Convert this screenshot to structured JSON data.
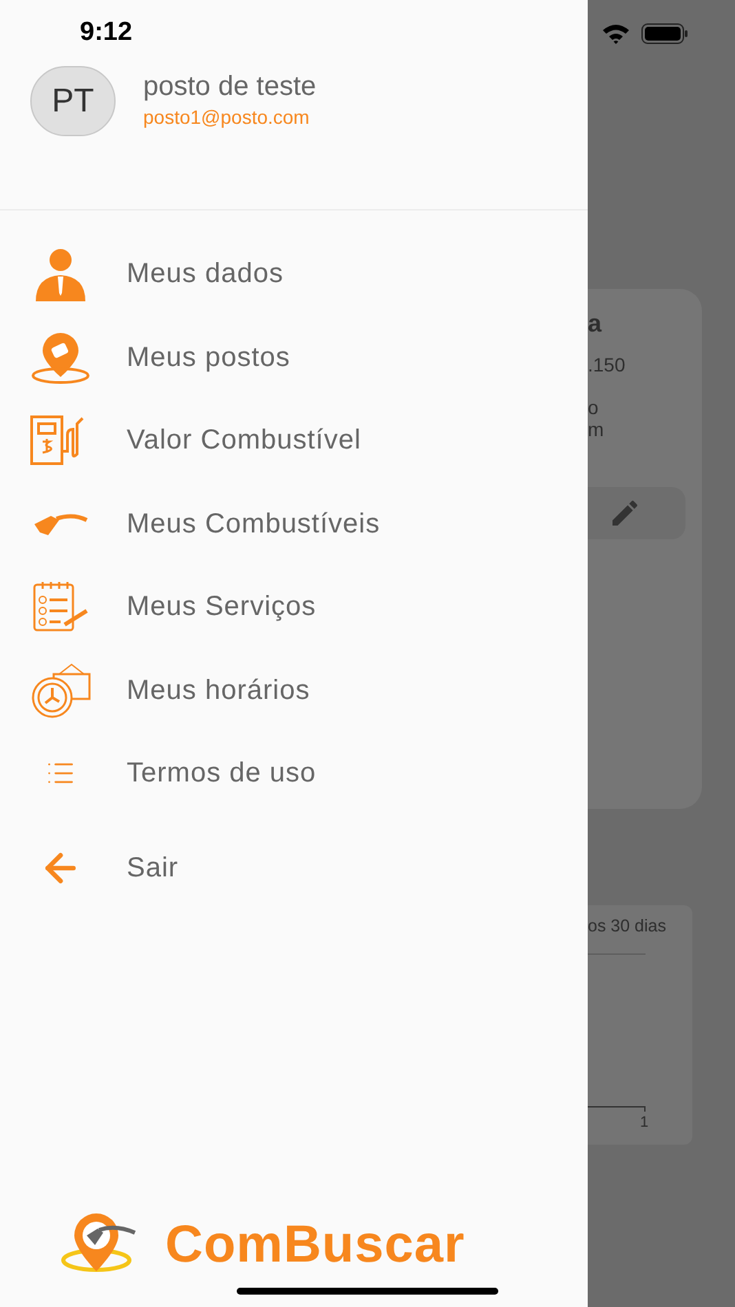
{
  "status_bar": {
    "time": "9:12"
  },
  "profile": {
    "initials": "PT",
    "name": "posto de teste",
    "email": "posto1@posto.com"
  },
  "menu": [
    {
      "kind": "person",
      "label": "Meus dados"
    },
    {
      "kind": "pin",
      "label": "Meus postos"
    },
    {
      "kind": "pump",
      "label": "Valor Combustível"
    },
    {
      "kind": "nozzle",
      "label": "Meus Combustíveis"
    },
    {
      "kind": "checklist",
      "label": "Meus Serviços"
    },
    {
      "kind": "clock",
      "label": "Meus horários"
    },
    {
      "kind": "list",
      "label": "Termos de uso"
    },
    {
      "kind": "back",
      "label": "Sair"
    }
  ],
  "logo": {
    "text": "ComBuscar"
  },
  "background": {
    "card_title": "a",
    "card_line_1": ".150",
    "card_line_2": "o",
    "card_line_3": "m",
    "chart_caption": "os 30 dias",
    "axis_tick": "1"
  }
}
